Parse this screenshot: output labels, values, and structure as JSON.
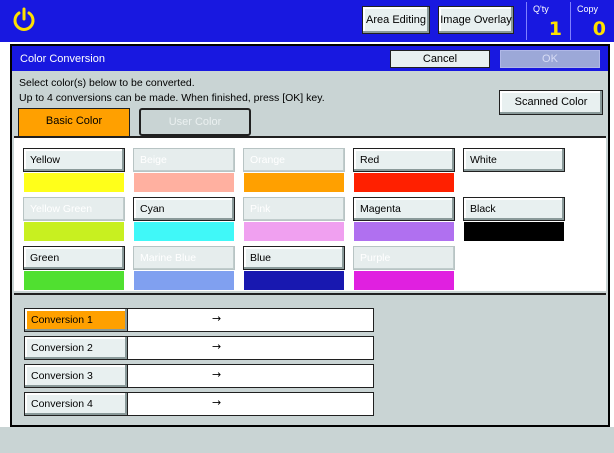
{
  "header": {
    "power_icon": "power-icon",
    "area_editing_label": "Area Editing",
    "image_overlay_label": "Image Overlay",
    "qty_label": "Q'ty",
    "qty_value": "1",
    "copy_label": "Copy",
    "copy_value": "0"
  },
  "dialog": {
    "title": "Color Conversion",
    "cancel_label": "Cancel",
    "ok_label": "OK",
    "instruction_line1": "Select color(s) below to be converted.",
    "instruction_line2": "Up to 4 conversions can be made. When finished, press [OK] key.",
    "scanned_color_label": "Scanned Color",
    "tabs": [
      {
        "label": "Basic Color",
        "active": true
      },
      {
        "label": "User Color",
        "active": false
      }
    ]
  },
  "colors": [
    {
      "label": "Yellow",
      "swatch": "#ffff1a",
      "enabled": true
    },
    {
      "label": "Beige",
      "swatch": "#ffb0a0",
      "enabled": false
    },
    {
      "label": "Orange",
      "swatch": "#ffa000",
      "enabled": false
    },
    {
      "label": "Red",
      "swatch": "#ff2000",
      "enabled": true
    },
    {
      "label": "White",
      "swatch": "#ffffff",
      "enabled": true
    },
    {
      "label": "Yellow Green",
      "swatch": "#c8f020",
      "enabled": false
    },
    {
      "label": "Cyan",
      "swatch": "#40f8f8",
      "enabled": true
    },
    {
      "label": "Pink",
      "swatch": "#f0a0f0",
      "enabled": false
    },
    {
      "label": "Magenta",
      "swatch": "#b070f0",
      "enabled": true
    },
    {
      "label": "Black",
      "swatch": "#000000",
      "enabled": true
    },
    {
      "label": "Green",
      "swatch": "#50e030",
      "enabled": true
    },
    {
      "label": "Marine Blue",
      "swatch": "#80a0f0",
      "enabled": false
    },
    {
      "label": "Blue",
      "swatch": "#1818b0",
      "enabled": true
    },
    {
      "label": "Purple",
      "swatch": "#e020e0",
      "enabled": false
    }
  ],
  "conversions": [
    {
      "label": "Conversion 1",
      "arrow": "→",
      "active": true
    },
    {
      "label": "Conversion 2",
      "arrow": "→",
      "active": false
    },
    {
      "label": "Conversion 3",
      "arrow": "→",
      "active": false
    },
    {
      "label": "Conversion 4",
      "arrow": "→",
      "active": false
    }
  ],
  "theme": {
    "accent_blue": "#1818e0",
    "panel_gray": "#c9d4d4",
    "highlight_orange": "#ffa000",
    "counter_yellow": "#ffe000"
  }
}
